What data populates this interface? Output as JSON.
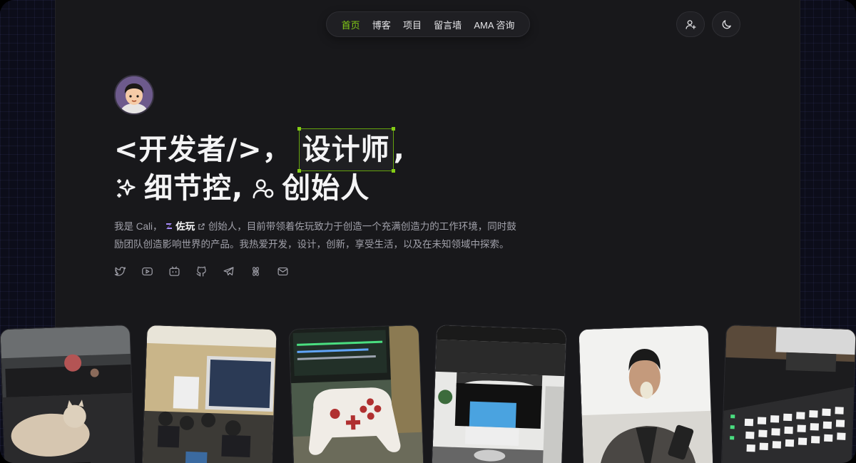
{
  "nav": {
    "items": [
      {
        "label": "首页",
        "active": true
      },
      {
        "label": "博客"
      },
      {
        "label": "项目"
      },
      {
        "label": "留言墙"
      },
      {
        "label": "AMA 咨询"
      }
    ]
  },
  "header_buttons": {
    "subscribe_icon": "user-plus-icon",
    "theme_icon": "moon-icon"
  },
  "headline": {
    "part1": "<开发者/>，",
    "highlight": "设计师",
    "part1_end": ",",
    "part2a": "细节控,",
    "part2b": "创始人"
  },
  "intro": {
    "prefix": "我是 Cali，",
    "brand": "佐玩",
    "suffix": "创始人，目前带领着佐玩致力于创造一个充满创造力的工作环境，同时鼓励团队创造影响世界的产品。我热爱开发，设计，创新，享受生活，以及在未知领域中探索。"
  },
  "socials": [
    "twitter-icon",
    "youtube-icon",
    "bilibili-icon",
    "github-icon",
    "telegram-icon",
    "rss-atom-icon",
    "mail-icon"
  ],
  "photos": [
    "cat-on-desk-photo",
    "classroom-presentation-photo",
    "game-controller-photo",
    "office-stage-photo",
    "person-drinking-photo",
    "music-launchpad-photo"
  ],
  "colors": {
    "accent": "#84cc16",
    "panel": "#18181b",
    "background": "#0c0d1a"
  }
}
